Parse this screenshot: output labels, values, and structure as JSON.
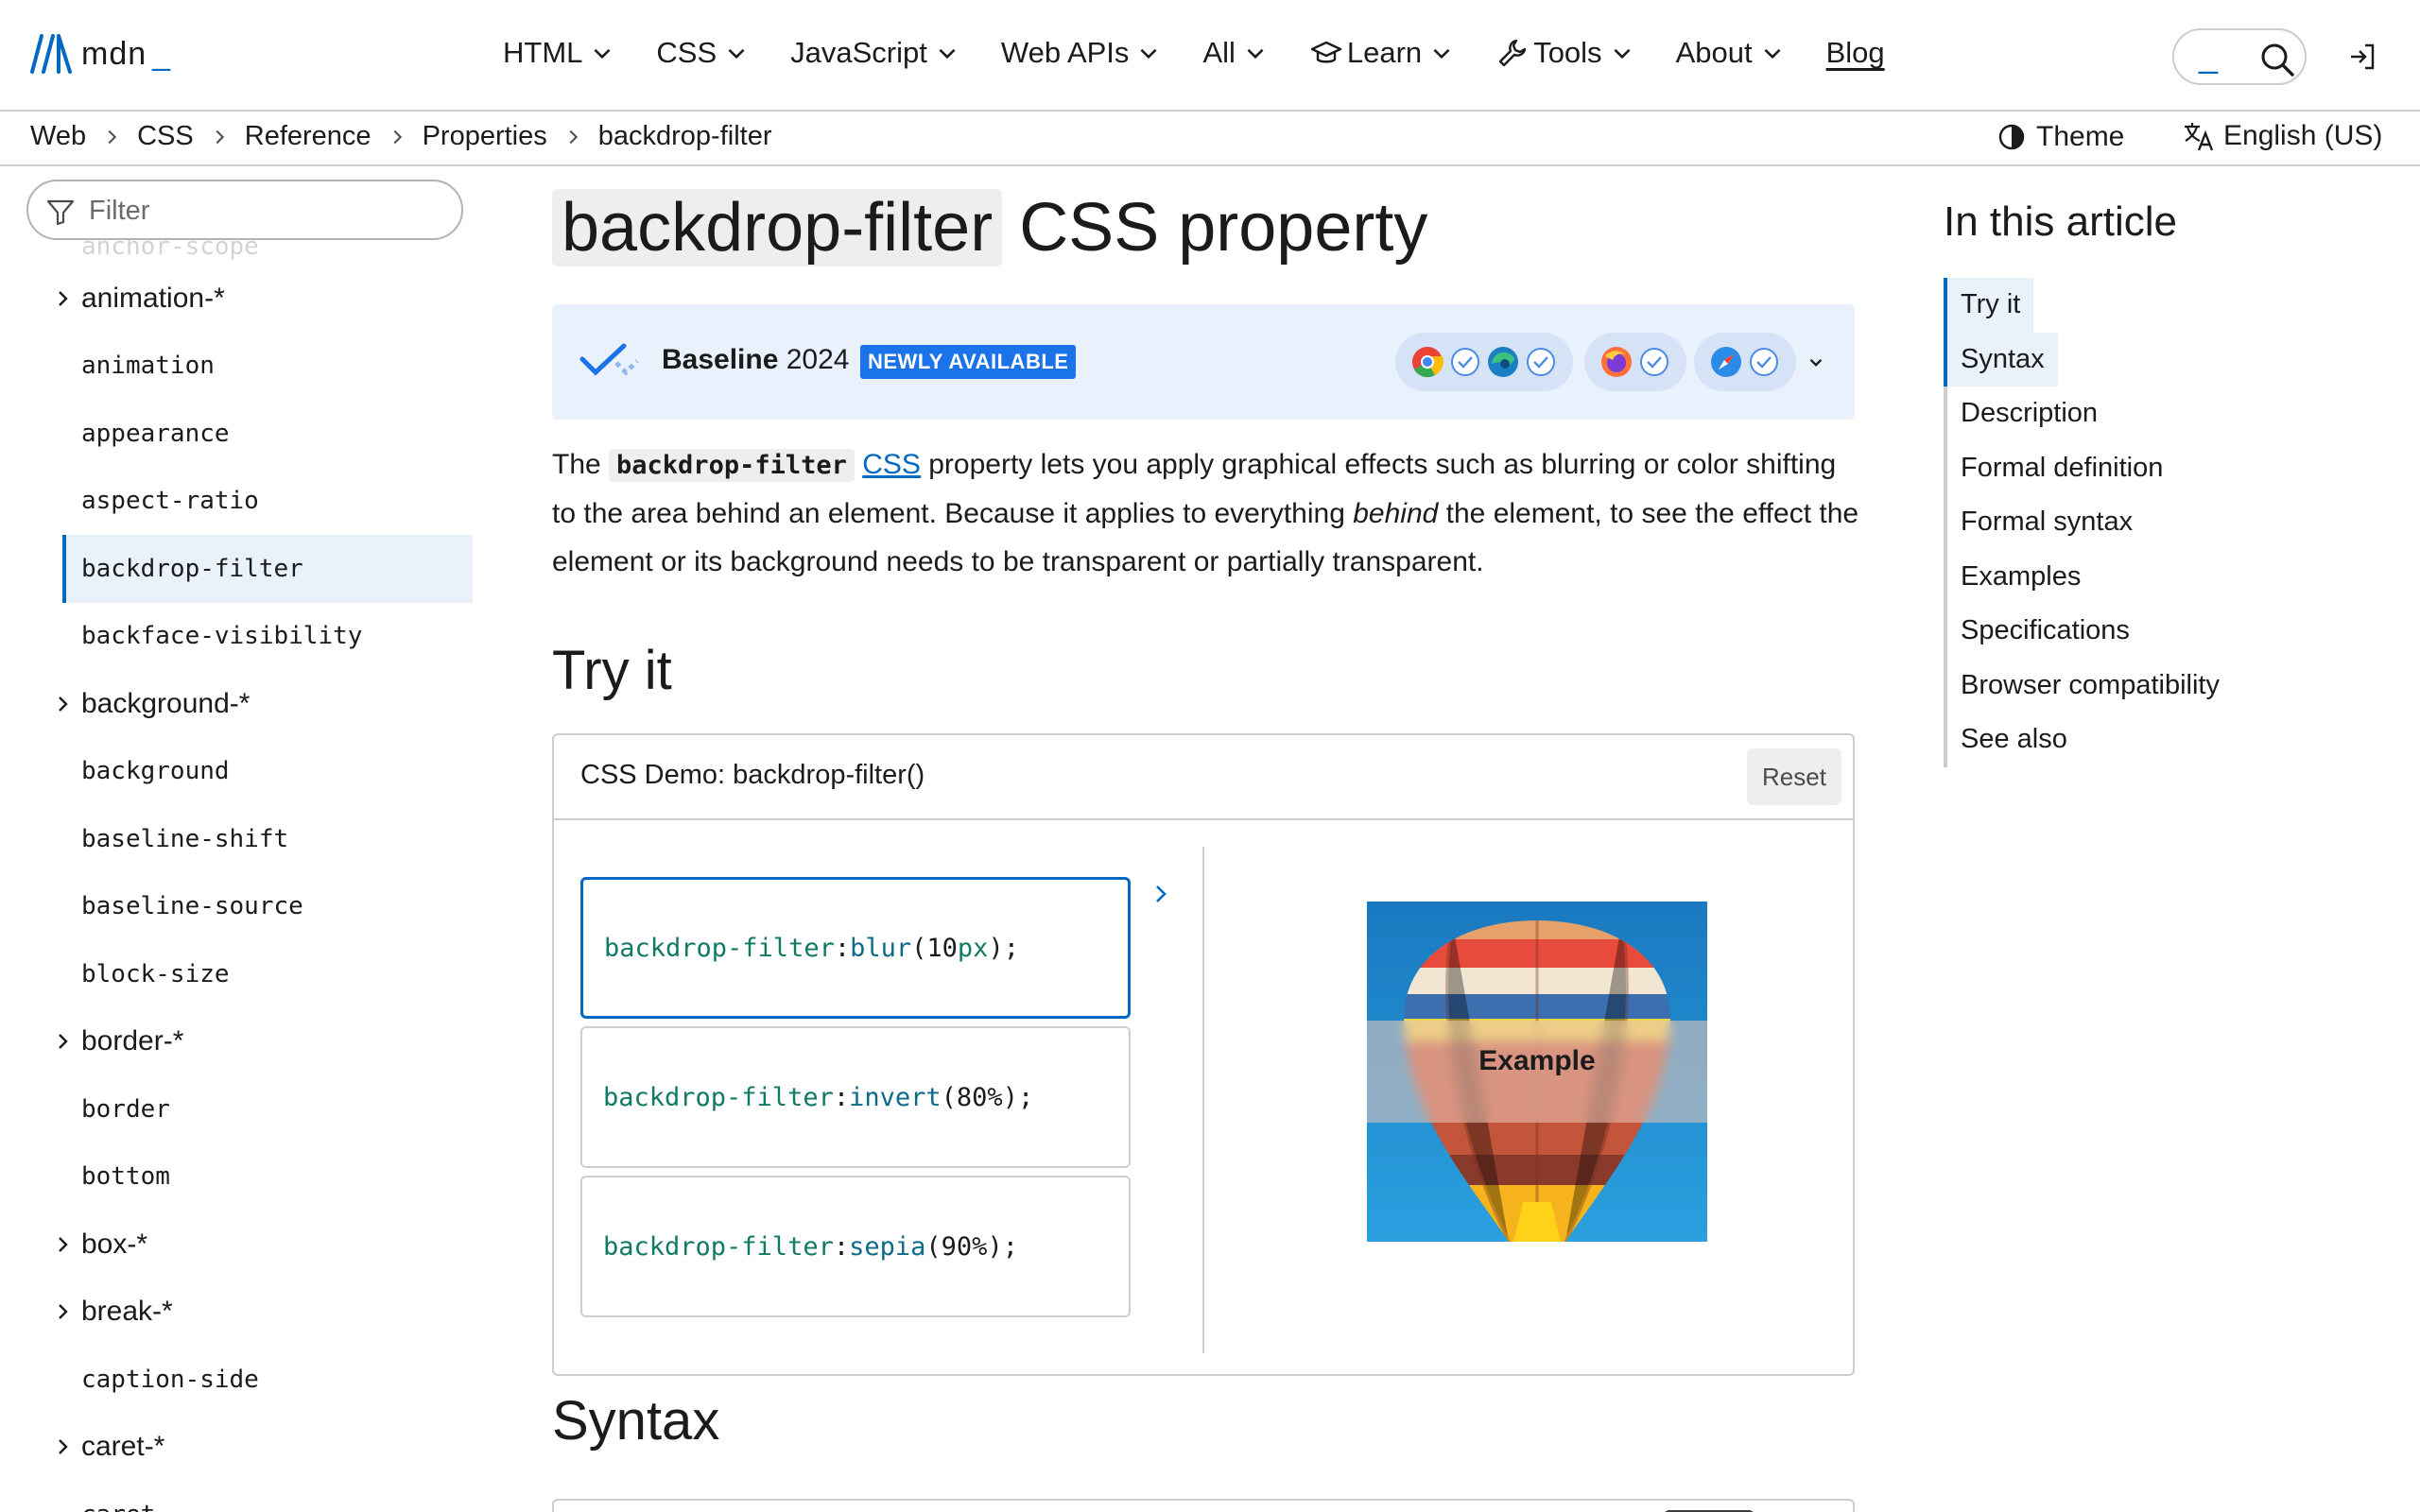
{
  "header": {
    "logo_text": "mdn",
    "logo_cursor": "_",
    "nav": [
      {
        "label": "HTML"
      },
      {
        "label": "CSS"
      },
      {
        "label": "JavaScript"
      },
      {
        "label": "Web APIs"
      },
      {
        "label": "All"
      },
      {
        "label": "Learn"
      },
      {
        "label": "Tools"
      },
      {
        "label": "About"
      }
    ],
    "blog_label": "Blog",
    "search_cursor": "_"
  },
  "breadcrumb": [
    "Web",
    "CSS",
    "Reference",
    "Properties",
    "backdrop-filter"
  ],
  "theme_label": "Theme",
  "language_label": "English (US)",
  "sidebar": {
    "filter_placeholder": "Filter",
    "peek_text": "anchor-scope",
    "items": [
      {
        "label": "animation-*",
        "group": true
      },
      {
        "label": "animation"
      },
      {
        "label": "appearance"
      },
      {
        "label": "aspect-ratio"
      },
      {
        "label": "backdrop-filter",
        "active": true
      },
      {
        "label": "backface-visibility"
      },
      {
        "label": "background-*",
        "group": true
      },
      {
        "label": "background"
      },
      {
        "label": "baseline-shift"
      },
      {
        "label": "baseline-source"
      },
      {
        "label": "block-size"
      },
      {
        "label": "border-*",
        "group": true
      },
      {
        "label": "border"
      },
      {
        "label": "bottom"
      },
      {
        "label": "box-*",
        "group": true
      },
      {
        "label": "break-*",
        "group": true
      },
      {
        "label": "caption-side"
      },
      {
        "label": "caret-*",
        "group": true
      },
      {
        "label": "caret"
      }
    ]
  },
  "article": {
    "title_code": "backdrop-filter",
    "title_rest": "CSS property",
    "baseline": {
      "label": "Baseline",
      "year": "2024",
      "badge": "NEWLY AVAILABLE"
    },
    "intro": {
      "p1": "The ",
      "code": "backdrop-filter",
      "p2": " ",
      "link": "CSS",
      "p3": " property lets you apply graphical effects such as blurring or color shifting to the area behind an element. Because it applies to everything ",
      "em": "behind",
      "p4": " the element, to see the effect the element or its background needs to be transparent or partially transparent."
    },
    "try_it_heading": "Try it",
    "demo": {
      "title": "CSS Demo: backdrop-filter()",
      "reset_label": "Reset",
      "choices": [
        {
          "prop": "backdrop-filter",
          "fn": "blur",
          "open": "(",
          "num": "10",
          "unit": "px",
          "close": ");"
        },
        {
          "prop": "backdrop-filter",
          "fn": "invert",
          "open": "(",
          "num": "80%",
          "unit": "",
          "close": ");"
        },
        {
          "prop": "backdrop-filter",
          "fn": "sepia",
          "open": "(",
          "num": "90%",
          "unit": "",
          "close": ");"
        }
      ],
      "example_label": "Example"
    },
    "syntax_heading": "Syntax"
  },
  "toc": {
    "title": "In this article",
    "items": [
      "Try it",
      "Syntax",
      "Description",
      "Formal definition",
      "Formal syntax",
      "Examples",
      "Specifications",
      "Browser compatibility",
      "See also"
    ]
  }
}
